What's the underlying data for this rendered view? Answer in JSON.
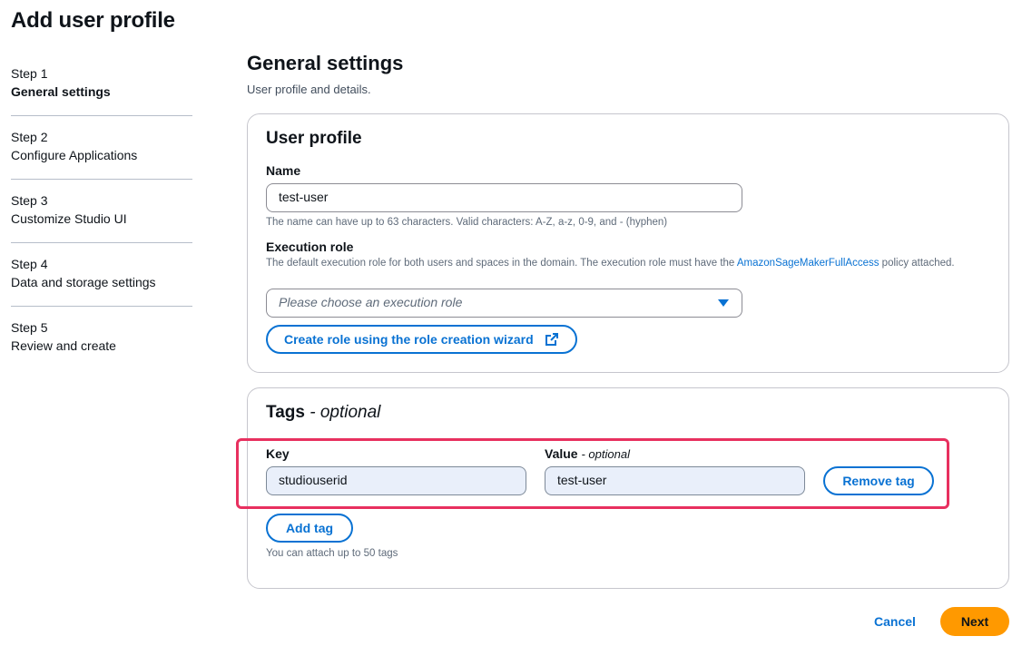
{
  "page": {
    "title": "Add user profile"
  },
  "steps": [
    {
      "num": "Step 1",
      "name": "General settings",
      "active": true
    },
    {
      "num": "Step 2",
      "name": "Configure Applications"
    },
    {
      "num": "Step 3",
      "name": "Customize Studio UI"
    },
    {
      "num": "Step 4",
      "name": "Data and storage settings"
    },
    {
      "num": "Step 5",
      "name": "Review and create"
    }
  ],
  "general": {
    "title": "General settings",
    "description": "User profile and details."
  },
  "user_profile": {
    "title": "User profile",
    "name_label": "Name",
    "name_value": "test-user",
    "name_hint": "The name can have up to 63 characters. Valid characters: A-Z, a-z, 0-9, and - (hyphen)",
    "role_label": "Execution role",
    "role_hint_pre": "The default execution role for both users and spaces in the domain. The execution role must have the ",
    "role_hint_link": "AmazonSageMakerFullAccess",
    "role_hint_post": " policy attached.",
    "role_placeholder": "Please choose an execution role",
    "create_role_button": "Create role using the role creation wizard"
  },
  "tags": {
    "title": "Tags",
    "title_optional": "- optional",
    "key_label": "Key",
    "value_label": "Value",
    "value_optional": "- optional",
    "key_value": "studiouserid",
    "value_value": "test-user",
    "remove_button": "Remove tag",
    "add_button": "Add tag",
    "hint": "You can attach up to 50 tags"
  },
  "footer": {
    "cancel": "Cancel",
    "next": "Next"
  },
  "colors": {
    "link": "#0972d3",
    "primary": "#ff9900",
    "highlight": "#e8305f"
  }
}
